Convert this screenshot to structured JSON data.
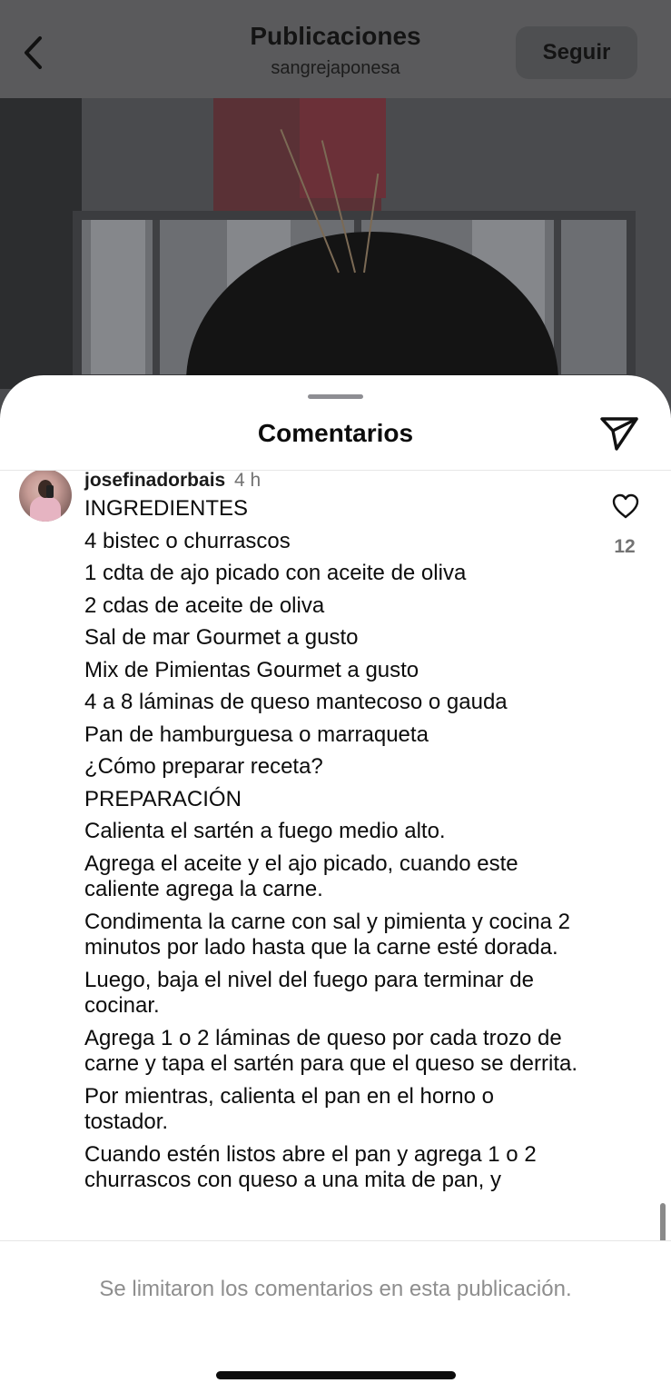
{
  "header": {
    "title": "Publicaciones",
    "subtitle": "sangrejaponesa",
    "follow_label": "Seguir",
    "back_icon": "chevron-left-icon"
  },
  "sheet": {
    "title": "Comentarios",
    "share_icon": "paper-plane-icon"
  },
  "comment": {
    "username": "josefinadorbais",
    "time": "4 h",
    "likes": "12",
    "like_icon": "heart-outline-icon",
    "lines": [
      "INGREDIENTES",
      "4 bistec o churrascos",
      "1 cdta de ajo picado con aceite de oliva",
      "2 cdas de aceite de oliva",
      "Sal de mar Gourmet a gusto",
      "Mix de Pimientas Gourmet a gusto",
      "4 a 8 láminas de queso mantecoso o gauda",
      "Pan de hamburguesa o marraqueta",
      "¿Cómo preparar receta?",
      "PREPARACIÓN",
      "Calienta el sartén a fuego medio alto.",
      "Agrega el aceite y el ajo picado, cuando este caliente agrega la carne.",
      "Condimenta la carne con sal y pimienta y cocina 2 minutos por lado hasta que la carne esté dorada.",
      "Luego, baja el nivel del fuego para terminar de cocinar.",
      "Agrega 1 o 2 láminas de queso por cada trozo de carne y tapa el sartén para que el queso se derrita.",
      "Por mientras, calienta el pan en el horno o tostador.",
      "Cuando estén listos abre el pan y agrega 1 o 2 churrascos con queso a una mita de pan, y"
    ]
  },
  "footer": {
    "note": "Se limitaron los comentarios en esta publicación."
  }
}
